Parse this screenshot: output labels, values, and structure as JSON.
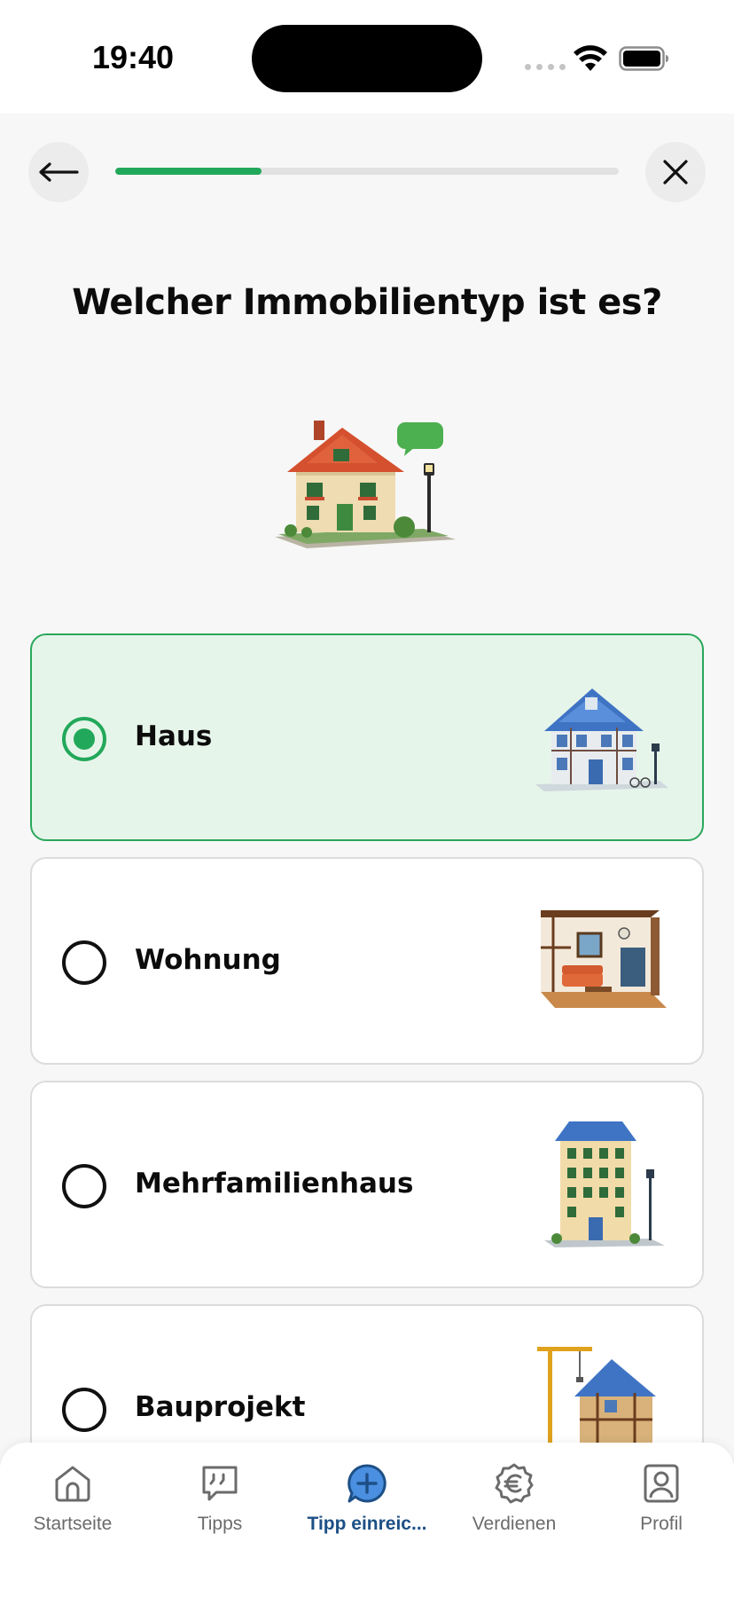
{
  "status_bar": {
    "time": "19:40"
  },
  "progress": {
    "fraction": 0.29
  },
  "question": {
    "title": "Welcher Immobilientyp ist es?"
  },
  "options": [
    {
      "label": "Haus",
      "selected": true,
      "image": "house-illustration"
    },
    {
      "label": "Wohnung",
      "selected": false,
      "image": "apartment-interior-illustration"
    },
    {
      "label": "Mehrfamilienhaus",
      "selected": false,
      "image": "multi-family-house-illustration"
    },
    {
      "label": "Bauprojekt",
      "selected": false,
      "image": "construction-project-illustration"
    }
  ],
  "tab_bar": {
    "items": [
      {
        "label": "Startseite",
        "icon": "home-icon",
        "active": false
      },
      {
        "label": "Tipps",
        "icon": "quote-bubble-icon",
        "active": false
      },
      {
        "label": "Tipp einreic...",
        "icon": "add-bubble-icon",
        "active": true
      },
      {
        "label": "Verdienen",
        "icon": "euro-icon",
        "active": false
      },
      {
        "label": "Profil",
        "icon": "profile-icon",
        "active": false
      }
    ]
  },
  "colors": {
    "accent_green": "#22a85a",
    "selected_bg": "#e6f5ea",
    "active_tab": "#1d4f86"
  }
}
